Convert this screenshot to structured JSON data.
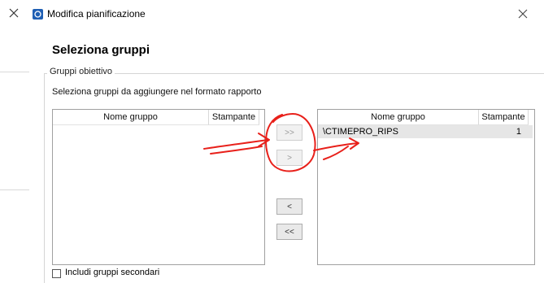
{
  "window": {
    "title": "Modifica pianificazione"
  },
  "section": {
    "title": "Seleziona gruppi"
  },
  "groupbox": {
    "legend": "Gruppi obiettivo",
    "instruction": "Seleziona gruppi da aggiungere nel formato rapporto"
  },
  "left_list": {
    "headers": {
      "name": "Nome gruppo",
      "printer": "Stampante"
    }
  },
  "right_list": {
    "headers": {
      "name": "Nome gruppo",
      "printer": "Stampante"
    },
    "rows": [
      {
        "name": "\\CTIMEPRO_RIPS",
        "printer": "1"
      }
    ]
  },
  "buttons": {
    "add_all": ">>",
    "add": ">",
    "remove": "<",
    "remove_all": "<<"
  },
  "checkbox": {
    "label": "Includi gruppi secondari",
    "checked": false
  },
  "icons": {
    "outer_close": "close-icon",
    "window_icon": "app-icon",
    "window_close": "close-icon"
  },
  "colors": {
    "annotation": "#e8201a",
    "window_icon": "#1f5fb4"
  }
}
